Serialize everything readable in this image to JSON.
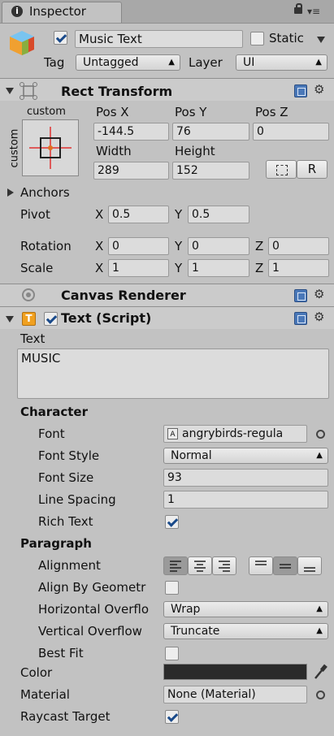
{
  "tab": {
    "title": "Inspector",
    "info_glyph": "i"
  },
  "header": {
    "object_name": "Music Text",
    "static_label": "Static",
    "tag_label": "Tag",
    "tag_value": "Untagged",
    "layer_label": "Layer",
    "layer_value": "UI"
  },
  "rect_transform": {
    "title": "Rect Transform",
    "anchor_preset_top": "custom",
    "anchor_preset_side": "custom",
    "posx_label": "Pos X",
    "posy_label": "Pos Y",
    "posz_label": "Pos Z",
    "posx": "-144.5",
    "posy": "76",
    "posz": "0",
    "width_label": "Width",
    "height_label": "Height",
    "width": "289",
    "height": "152",
    "raw_button": "R",
    "anchors_label": "Anchors",
    "pivot_label": "Pivot",
    "pivot_x": "0.5",
    "pivot_y": "0.5",
    "rotation_label": "Rotation",
    "rot_x": "0",
    "rot_y": "0",
    "rot_z": "0",
    "scale_label": "Scale",
    "scale_x": "1",
    "scale_y": "1",
    "scale_z": "1",
    "x": "X",
    "y": "Y",
    "z": "Z"
  },
  "canvas_renderer": {
    "title": "Canvas Renderer"
  },
  "text_script": {
    "title": "Text (Script)",
    "text_label": "Text",
    "text_value": "MUSIC",
    "character_heading": "Character",
    "font_label": "Font",
    "font_value": "angrybirds-regula",
    "font_style_label": "Font Style",
    "font_style_value": "Normal",
    "font_size_label": "Font Size",
    "font_size_value": "93",
    "line_spacing_label": "Line Spacing",
    "line_spacing_value": "1",
    "rich_text_label": "Rich Text",
    "paragraph_heading": "Paragraph",
    "alignment_label": "Alignment",
    "align_by_geometry_label": "Align By Geometr",
    "horizontal_overflow_label": "Horizontal Overflo",
    "horizontal_overflow_value": "Wrap",
    "vertical_overflow_label": "Vertical Overflow",
    "vertical_overflow_value": "Truncate",
    "best_fit_label": "Best Fit",
    "color_label": "Color",
    "color_value": "#2a2a2a",
    "material_label": "Material",
    "material_value": "None (Material)",
    "raycast_label": "Raycast Target"
  }
}
